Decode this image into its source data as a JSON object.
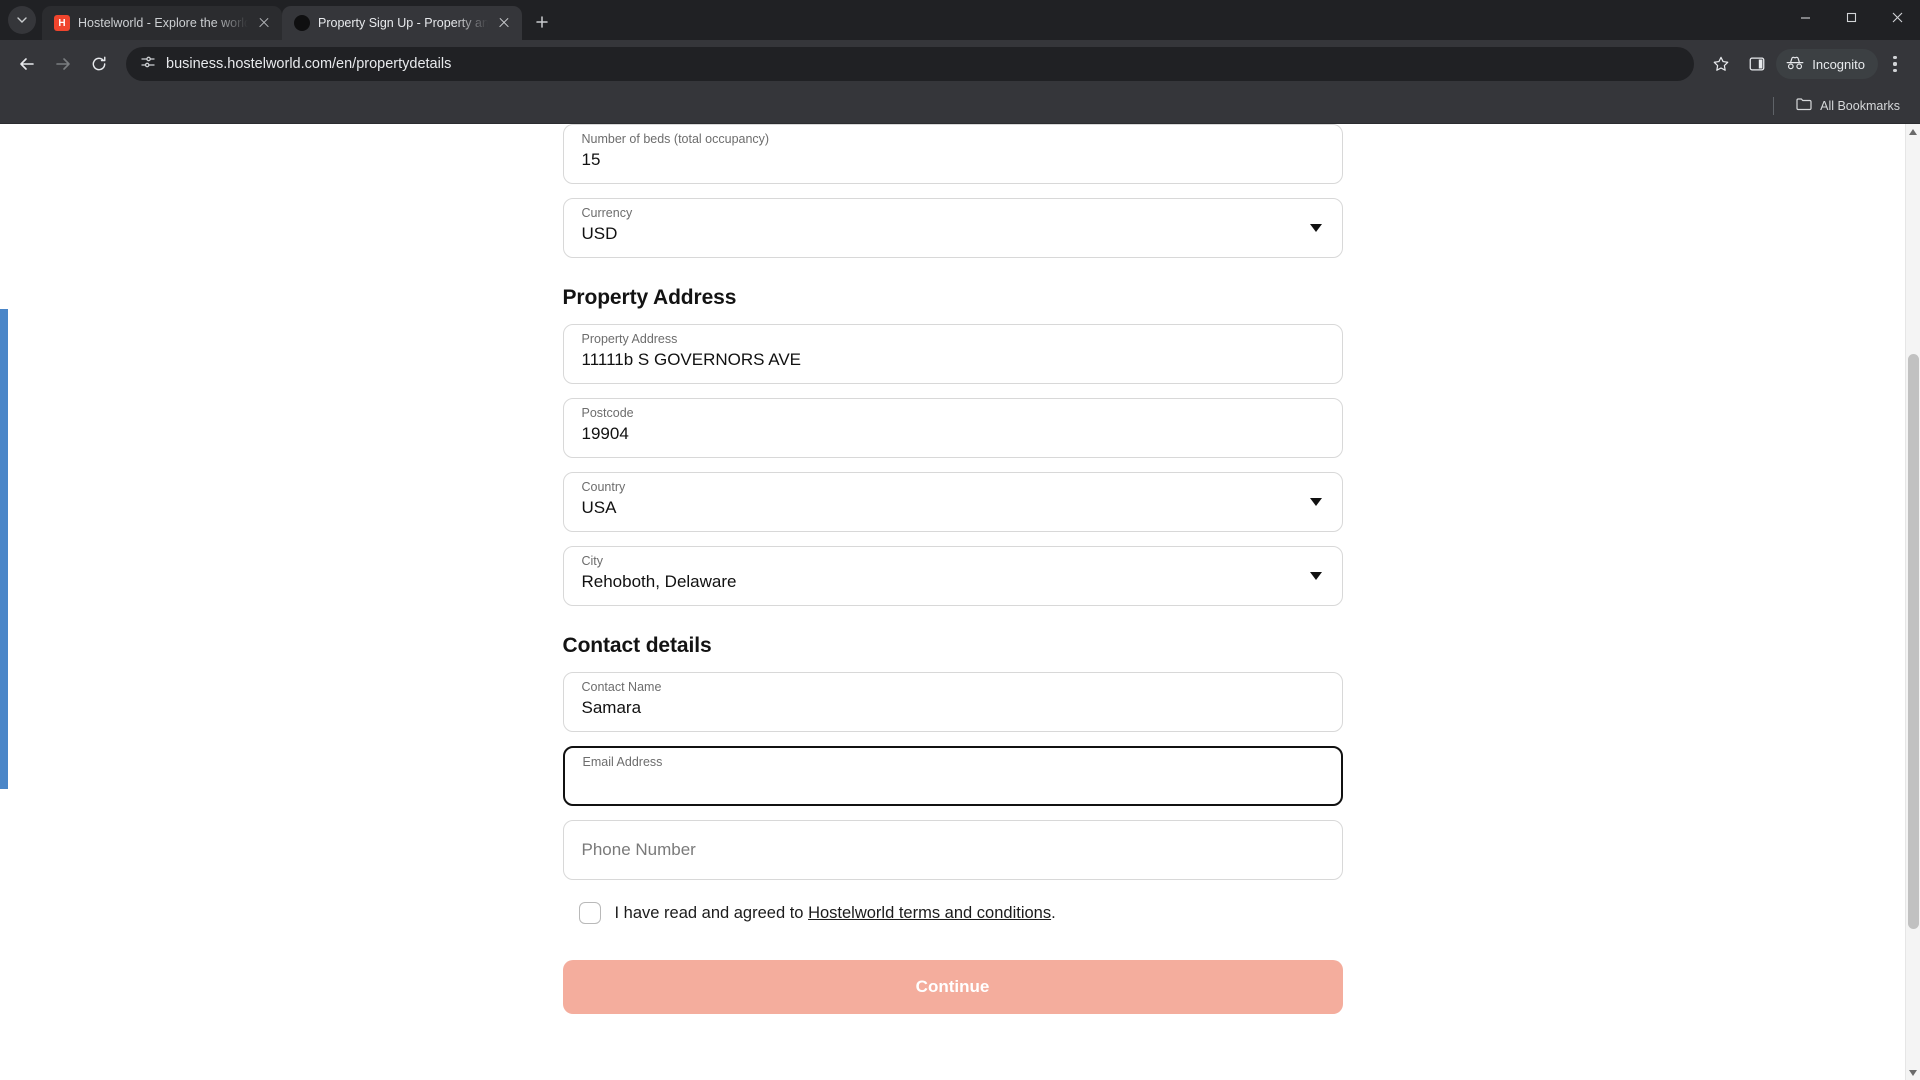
{
  "browser": {
    "tab_list_icon": "chevron-down-icon",
    "tabs": [
      {
        "title": "Hostelworld - Explore the world",
        "favicon": "hostelworld-icon",
        "active": false
      },
      {
        "title": "Property Sign Up - Property and",
        "favicon": "loading-dot-icon",
        "active": true
      }
    ],
    "new_tab_label": "+",
    "window_controls": {
      "minimize": "—",
      "maximize": "❐",
      "close": "✕"
    },
    "nav": {
      "back": "back-arrow-icon",
      "forward": "forward-arrow-icon",
      "reload": "reload-icon"
    },
    "omnibox": {
      "site_icon": "page-settings-icon",
      "url": "business.hostelworld.com/en/propertydetails",
      "bookmark_icon": "star-icon",
      "side_panel_icon": "side-panel-icon"
    },
    "incognito_label": "Incognito",
    "incognito_icon": "incognito-hat-icon",
    "menu_icon": "three-dot-menu-icon",
    "bookmarks": {
      "folder_icon": "folder-icon",
      "label": "All Bookmarks"
    }
  },
  "page": {
    "fields": {
      "beds": {
        "label": "Number of beds (total occupancy)",
        "value": "15"
      },
      "currency": {
        "label": "Currency",
        "value": "USD"
      },
      "property_address": {
        "label": "Property Address",
        "value": "11111b S GOVERNORS AVE"
      },
      "postcode": {
        "label": "Postcode",
        "value": "19904"
      },
      "country": {
        "label": "Country",
        "value": "USA"
      },
      "city": {
        "label": "City",
        "value": "Rehoboth, Delaware"
      },
      "contact_name": {
        "label": "Contact Name",
        "value": "Samara"
      },
      "email": {
        "label": "Email Address",
        "value": ""
      },
      "phone": {
        "placeholder": "Phone Number",
        "value": ""
      }
    },
    "sections": {
      "property_address_title": "Property Address",
      "contact_details_title": "Contact details"
    },
    "terms": {
      "prefix": "I have read and agreed to ",
      "link": "Hostelworld terms and conditions",
      "suffix": ".",
      "checked": false
    },
    "continue_label": "Continue",
    "colors": {
      "continue_bg": "#f4ad9d",
      "focus_border": "#111111",
      "accent_blue": "#4a86c8"
    }
  }
}
